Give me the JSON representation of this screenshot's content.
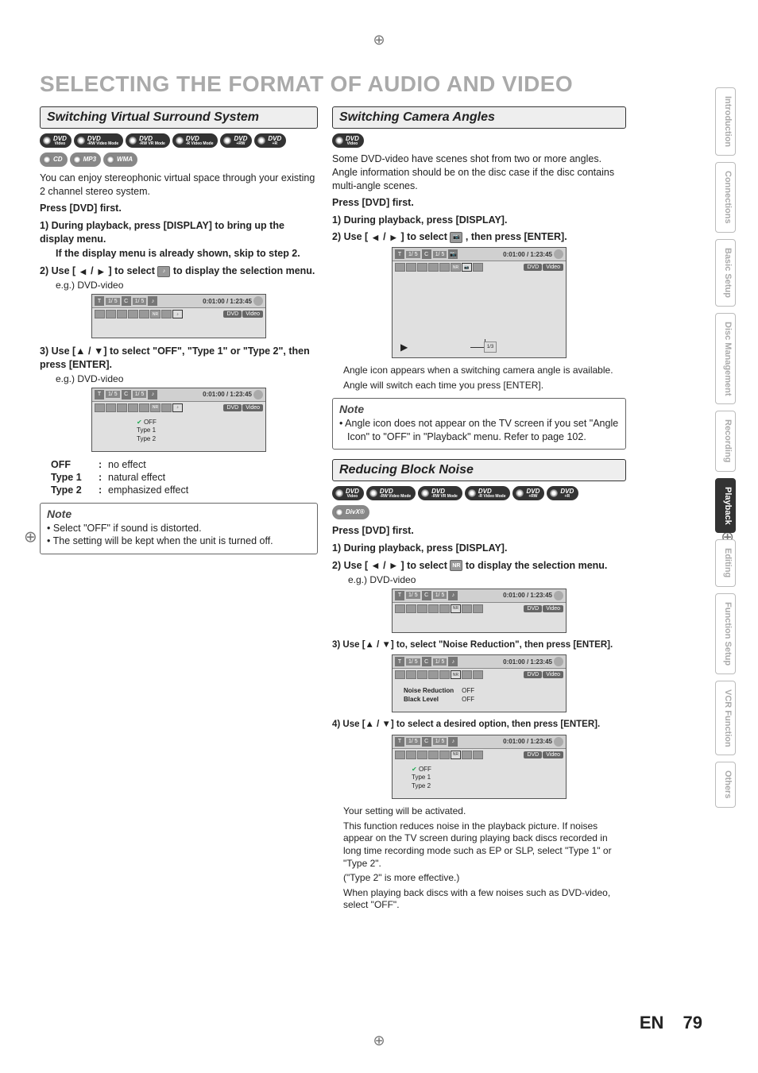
{
  "page_title": "SELECTING THE FORMAT OF AUDIO AND VIDEO",
  "page_number": "79",
  "page_lang": "EN",
  "side_tabs": [
    {
      "label": "Introduction",
      "active": false
    },
    {
      "label": "Connections",
      "active": false
    },
    {
      "label": "Basic Setup",
      "active": false
    },
    {
      "label": "Disc Management",
      "active": false
    },
    {
      "label": "Recording",
      "active": false
    },
    {
      "label": "Playback",
      "active": true
    },
    {
      "label": "Editing",
      "active": false
    },
    {
      "label": "Function Setup",
      "active": false
    },
    {
      "label": "VCR Function",
      "active": false
    },
    {
      "label": "Others",
      "active": false
    }
  ],
  "left": {
    "section_title": "Switching Virtual Surround System",
    "discs_row1": [
      {
        "label": "DVD",
        "sub": "Video"
      },
      {
        "label": "DVD",
        "sub": "-RW Video Mode"
      },
      {
        "label": "DVD",
        "sub": "-RW VR Mode"
      },
      {
        "label": "DVD",
        "sub": "-R Video Mode"
      },
      {
        "label": "DVD",
        "sub": "+RW"
      },
      {
        "label": "DVD",
        "sub": "+R"
      }
    ],
    "discs_row2": [
      {
        "label": "CD",
        "sub": ""
      },
      {
        "label": "MP3",
        "sub": ""
      },
      {
        "label": "WMA",
        "sub": ""
      }
    ],
    "intro": "You can enjoy stereophonic virtual space through your existing 2 channel stereo system.",
    "press_first": "Press [DVD] first.",
    "step1_a": "1) During playback, press [DISPLAY] to bring up the display menu.",
    "step1_b": "If the display menu is already shown, skip to step 2.",
    "step2_a": "2) Use [",
    "step2_b": "] to select",
    "step2_c": "to display the selection menu.",
    "eg": "e.g.) DVD-video",
    "step3": "3) Use [▲ / ▼] to select \"OFF\", \"Type 1\" or \"Type 2\", then press [ENTER].",
    "osd": {
      "title_counter": "1/  5",
      "chapter_counter": "1/  5",
      "time": "0:01:00 / 1:23:45",
      "disc_type_a": "DVD",
      "disc_type_b": "Video",
      "menu": [
        "OFF",
        "Type 1",
        "Type 2"
      ]
    },
    "defs": [
      {
        "term": "OFF",
        "desc": "no effect"
      },
      {
        "term": "Type 1",
        "desc": "natural effect"
      },
      {
        "term": "Type 2",
        "desc": "emphasized effect"
      }
    ],
    "note_title": "Note",
    "notes": [
      "Select \"OFF\" if sound is distorted.",
      "The setting will be kept when the unit is turned off."
    ]
  },
  "camera": {
    "section_title": "Switching Camera Angles",
    "discs": [
      {
        "label": "DVD",
        "sub": "Video"
      }
    ],
    "intro": "Some DVD-video have scenes shot from two or more angles. Angle information should be on the disc case if the disc contains multi-angle scenes.",
    "press_first": "Press [DVD] first.",
    "step1": "1) During playback, press [DISPLAY].",
    "step2_a": "2) Use [",
    "step2_b": "] to select",
    "step2_c": ", then press [ENTER].",
    "osd": {
      "title_counter": "1/  5",
      "chapter_counter": "1/  5",
      "time": "0:01:00 / 1:23:45",
      "disc_type_a": "DVD",
      "disc_type_b": "Video",
      "angle_label": "1/3"
    },
    "after1": "Angle icon appears when a switching camera angle is available.",
    "after2": "Angle will switch each time you press [ENTER].",
    "note_title": "Note",
    "note_line": "Angle icon does not appear on the TV screen if you set \"Angle Icon\" to \"OFF\" in \"Playback\" menu. Refer to page 102."
  },
  "noise": {
    "section_title": "Reducing Block Noise",
    "discs_row1": [
      {
        "label": "DVD",
        "sub": "Video"
      },
      {
        "label": "DVD",
        "sub": "-RW Video Mode"
      },
      {
        "label": "DVD",
        "sub": "-RW VR Mode"
      },
      {
        "label": "DVD",
        "sub": "-R Video Mode"
      },
      {
        "label": "DVD",
        "sub": "+RW"
      },
      {
        "label": "DVD",
        "sub": "+R"
      }
    ],
    "discs_row2": [
      {
        "label": "DivX®",
        "sub": ""
      }
    ],
    "press_first": "Press [DVD] first.",
    "step1": "1) During playback, press [DISPLAY].",
    "step2_a": "2) Use [",
    "step2_b": "] to select",
    "step2_c": "to display the selection menu.",
    "nr_label": "NR",
    "eg": "e.g.) DVD-video",
    "step3": "3) Use [▲ / ▼] to, select \"Noise Reduction\", then press [ENTER].",
    "step4": "4) Use [▲ / ▼] to select a desired option, then press [ENTER].",
    "osd": {
      "title_counter": "1/  5",
      "chapter_counter": "1/  5",
      "time": "0:01:00 / 1:23:45",
      "disc_type_a": "DVD",
      "disc_type_b": "Video",
      "settings": [
        {
          "name": "Noise Reduction",
          "value": "OFF"
        },
        {
          "name": "Black Level",
          "value": "OFF"
        }
      ],
      "menu": [
        "OFF",
        "Type 1",
        "Type 2"
      ]
    },
    "after1": "Your setting will be activated.",
    "after2": "This function reduces noise in the playback picture. If noises appear on the TV screen during playing back discs recorded in long time recording mode such as EP or SLP, select \"Type 1\" or \"Type 2\".",
    "after3": "(\"Type 2\" is more effective.)",
    "after4": "When playing back discs with a few noises such as DVD-video, select \"OFF\"."
  }
}
